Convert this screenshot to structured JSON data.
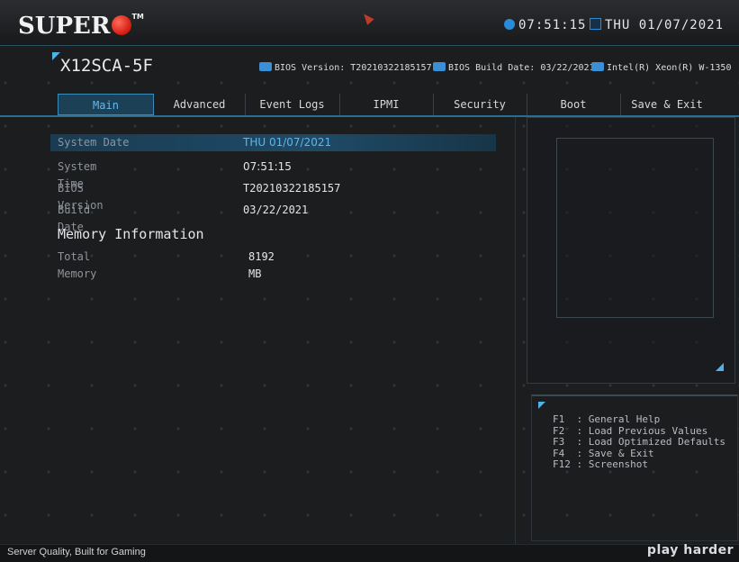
{
  "brand": {
    "logo": "SUPER",
    "tm": "TM"
  },
  "header": {
    "time": "07:51:15",
    "date": "THU 01/07/2021"
  },
  "info": {
    "model": "X12SCA-5F",
    "bios_version": "BIOS Version: T20210322185157",
    "bios_build_date": "BIOS Build Date: 03/22/2021",
    "cpu": "Intel(R) Xeon(R) W-1350"
  },
  "tabs": [
    {
      "label": "Main",
      "active": true
    },
    {
      "label": "Advanced"
    },
    {
      "label": "Event Logs"
    },
    {
      "label": "IPMI"
    },
    {
      "label": "Security"
    },
    {
      "label": "Boot"
    },
    {
      "label": "Save & Exit"
    }
  ],
  "main": {
    "rows": [
      {
        "label": "System Date",
        "value": "THU 01/07/2021"
      },
      {
        "label": "System Time",
        "value": "07:51:15"
      },
      {
        "label": "BIOS Version",
        "value": "T20210322185157"
      },
      {
        "label": "Build Date",
        "value": "03/22/2021"
      }
    ],
    "memory_heading": "Memory Information",
    "memory": {
      "label": "Total Memory",
      "value": "8192 MB"
    }
  },
  "help": [
    "F1  : General Help",
    "F2  : Load Previous Values",
    "F3  : Load Optimized Defaults",
    "F4  : Save & Exit",
    "F12 : Screenshot"
  ],
  "footer": {
    "slogan": "Server Quality, Built for Gaming",
    "tagline": "play harder"
  },
  "colors": {
    "accent": "#4fb3e8",
    "logo_ball": "#d31a10",
    "selected_row": "#1f4a66"
  }
}
